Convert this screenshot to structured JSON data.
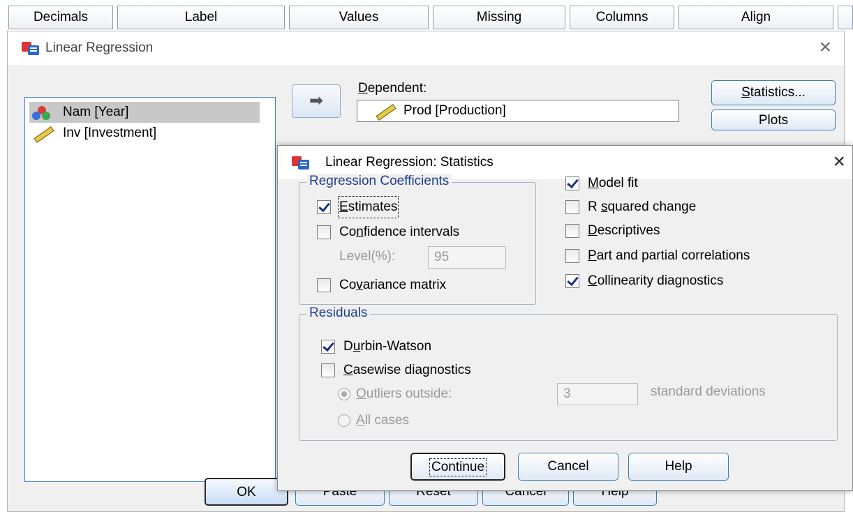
{
  "editor_header": {
    "columns": [
      "Decimals",
      "Label",
      "Values",
      "Missing",
      "Columns",
      "Align"
    ]
  },
  "main_window": {
    "title": "Linear Regression",
    "variables": [
      {
        "label": "Nam [Year]",
        "type": "nominal-icon",
        "selected": true
      },
      {
        "label": "Inv [Investment]",
        "type": "scale-icon",
        "selected": false
      }
    ],
    "dependent_label": "Dependent:",
    "dependent_value": "Prod [Production]",
    "side_buttons": [
      "Statistics...",
      "Plots"
    ],
    "bottom_buttons": [
      "OK",
      "Paste",
      "Reset",
      "Cancel",
      "Help"
    ]
  },
  "stats_dialog": {
    "title": "Linear Regression: Statistics",
    "regression_coefficients": {
      "legend": "Regression Coefficients",
      "estimates": {
        "label": "Estimates",
        "checked": true
      },
      "confidence_intervals": {
        "label": "Confidence intervals",
        "checked": false
      },
      "level_label": "Level(%):",
      "level_value": "95",
      "covariance_matrix": {
        "label": "Covariance matrix",
        "checked": false
      }
    },
    "right_options": [
      {
        "label": "Model fit",
        "checked": true
      },
      {
        "label": "R squared change",
        "checked": false
      },
      {
        "label": "Descriptives",
        "checked": false
      },
      {
        "label": "Part and partial correlations",
        "checked": false
      },
      {
        "label": "Collinearity diagnostics",
        "checked": true
      }
    ],
    "residuals": {
      "legend": "Residuals",
      "durbin_watson": {
        "label": "Durbin-Watson",
        "checked": true
      },
      "casewise": {
        "label": "Casewise diagnostics",
        "checked": false
      },
      "outliers_label": "Outliers outside:",
      "outliers_value": "3",
      "outliers_unit": "standard deviations",
      "all_cases_label": "All cases"
    },
    "buttons": {
      "continue": "Continue",
      "cancel": "Cancel",
      "help": "Help"
    }
  },
  "colors": {
    "accent": "#1f3f8f",
    "check": "#1b2f86",
    "button_border": "#3c7fb1"
  }
}
